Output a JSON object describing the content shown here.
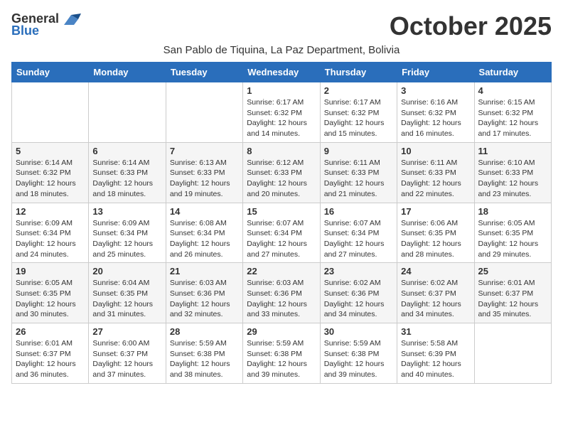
{
  "logo": {
    "general": "General",
    "blue": "Blue"
  },
  "title": "October 2025",
  "subtitle": "San Pablo de Tiquina, La Paz Department, Bolivia",
  "days_of_week": [
    "Sunday",
    "Monday",
    "Tuesday",
    "Wednesday",
    "Thursday",
    "Friday",
    "Saturday"
  ],
  "weeks": [
    [
      {
        "day": "",
        "info": ""
      },
      {
        "day": "",
        "info": ""
      },
      {
        "day": "",
        "info": ""
      },
      {
        "day": "1",
        "info": "Sunrise: 6:17 AM\nSunset: 6:32 PM\nDaylight: 12 hours\nand 14 minutes."
      },
      {
        "day": "2",
        "info": "Sunrise: 6:17 AM\nSunset: 6:32 PM\nDaylight: 12 hours\nand 15 minutes."
      },
      {
        "day": "3",
        "info": "Sunrise: 6:16 AM\nSunset: 6:32 PM\nDaylight: 12 hours\nand 16 minutes."
      },
      {
        "day": "4",
        "info": "Sunrise: 6:15 AM\nSunset: 6:32 PM\nDaylight: 12 hours\nand 17 minutes."
      }
    ],
    [
      {
        "day": "5",
        "info": "Sunrise: 6:14 AM\nSunset: 6:32 PM\nDaylight: 12 hours\nand 18 minutes."
      },
      {
        "day": "6",
        "info": "Sunrise: 6:14 AM\nSunset: 6:33 PM\nDaylight: 12 hours\nand 18 minutes."
      },
      {
        "day": "7",
        "info": "Sunrise: 6:13 AM\nSunset: 6:33 PM\nDaylight: 12 hours\nand 19 minutes."
      },
      {
        "day": "8",
        "info": "Sunrise: 6:12 AM\nSunset: 6:33 PM\nDaylight: 12 hours\nand 20 minutes."
      },
      {
        "day": "9",
        "info": "Sunrise: 6:11 AM\nSunset: 6:33 PM\nDaylight: 12 hours\nand 21 minutes."
      },
      {
        "day": "10",
        "info": "Sunrise: 6:11 AM\nSunset: 6:33 PM\nDaylight: 12 hours\nand 22 minutes."
      },
      {
        "day": "11",
        "info": "Sunrise: 6:10 AM\nSunset: 6:33 PM\nDaylight: 12 hours\nand 23 minutes."
      }
    ],
    [
      {
        "day": "12",
        "info": "Sunrise: 6:09 AM\nSunset: 6:34 PM\nDaylight: 12 hours\nand 24 minutes."
      },
      {
        "day": "13",
        "info": "Sunrise: 6:09 AM\nSunset: 6:34 PM\nDaylight: 12 hours\nand 25 minutes."
      },
      {
        "day": "14",
        "info": "Sunrise: 6:08 AM\nSunset: 6:34 PM\nDaylight: 12 hours\nand 26 minutes."
      },
      {
        "day": "15",
        "info": "Sunrise: 6:07 AM\nSunset: 6:34 PM\nDaylight: 12 hours\nand 27 minutes."
      },
      {
        "day": "16",
        "info": "Sunrise: 6:07 AM\nSunset: 6:34 PM\nDaylight: 12 hours\nand 27 minutes."
      },
      {
        "day": "17",
        "info": "Sunrise: 6:06 AM\nSunset: 6:35 PM\nDaylight: 12 hours\nand 28 minutes."
      },
      {
        "day": "18",
        "info": "Sunrise: 6:05 AM\nSunset: 6:35 PM\nDaylight: 12 hours\nand 29 minutes."
      }
    ],
    [
      {
        "day": "19",
        "info": "Sunrise: 6:05 AM\nSunset: 6:35 PM\nDaylight: 12 hours\nand 30 minutes."
      },
      {
        "day": "20",
        "info": "Sunrise: 6:04 AM\nSunset: 6:35 PM\nDaylight: 12 hours\nand 31 minutes."
      },
      {
        "day": "21",
        "info": "Sunrise: 6:03 AM\nSunset: 6:36 PM\nDaylight: 12 hours\nand 32 minutes."
      },
      {
        "day": "22",
        "info": "Sunrise: 6:03 AM\nSunset: 6:36 PM\nDaylight: 12 hours\nand 33 minutes."
      },
      {
        "day": "23",
        "info": "Sunrise: 6:02 AM\nSunset: 6:36 PM\nDaylight: 12 hours\nand 34 minutes."
      },
      {
        "day": "24",
        "info": "Sunrise: 6:02 AM\nSunset: 6:37 PM\nDaylight: 12 hours\nand 34 minutes."
      },
      {
        "day": "25",
        "info": "Sunrise: 6:01 AM\nSunset: 6:37 PM\nDaylight: 12 hours\nand 35 minutes."
      }
    ],
    [
      {
        "day": "26",
        "info": "Sunrise: 6:01 AM\nSunset: 6:37 PM\nDaylight: 12 hours\nand 36 minutes."
      },
      {
        "day": "27",
        "info": "Sunrise: 6:00 AM\nSunset: 6:37 PM\nDaylight: 12 hours\nand 37 minutes."
      },
      {
        "day": "28",
        "info": "Sunrise: 5:59 AM\nSunset: 6:38 PM\nDaylight: 12 hours\nand 38 minutes."
      },
      {
        "day": "29",
        "info": "Sunrise: 5:59 AM\nSunset: 6:38 PM\nDaylight: 12 hours\nand 39 minutes."
      },
      {
        "day": "30",
        "info": "Sunrise: 5:59 AM\nSunset: 6:38 PM\nDaylight: 12 hours\nand 39 minutes."
      },
      {
        "day": "31",
        "info": "Sunrise: 5:58 AM\nSunset: 6:39 PM\nDaylight: 12 hours\nand 40 minutes."
      },
      {
        "day": "",
        "info": ""
      }
    ]
  ]
}
